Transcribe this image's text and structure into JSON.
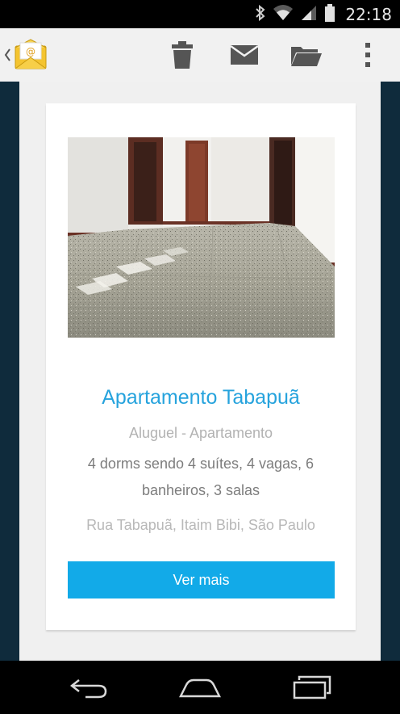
{
  "status_bar": {
    "time": "22:18",
    "icons": [
      "bluetooth-icon",
      "wifi-icon",
      "signal-icon",
      "battery-icon"
    ]
  },
  "action_bar": {
    "icons": [
      "back-chevron-icon",
      "email-app-icon",
      "trash-icon",
      "mark-unread-icon",
      "move-to-folder-icon",
      "overflow-menu-icon"
    ]
  },
  "listing": {
    "title": "Apartamento Tabapuã",
    "subtitle": "Aluguel - Apartamento",
    "details": "4 dorms sendo 4 suítes, 4 vagas, 6 banheiros, 3 salas",
    "address": "Rua Tabapuã, Itaim Bibi, São Paulo",
    "button_label": "Ver mais"
  },
  "nav_bar": {
    "icons": [
      "back-icon",
      "home-icon",
      "recents-icon"
    ]
  },
  "colors": {
    "accent": "#26a3dd",
    "button": "#12aae8",
    "frame": "#0f2b3c"
  }
}
